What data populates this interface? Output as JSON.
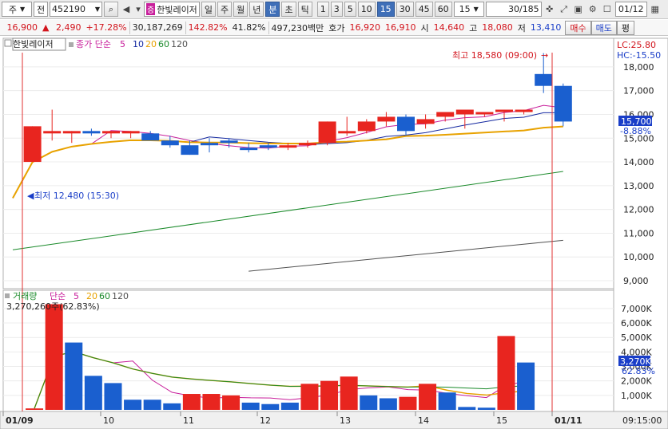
{
  "toolbar": {
    "market": "주",
    "market_label": "전",
    "code": "452190",
    "badge": "증",
    "stock_name": "한빛레이저",
    "periods": [
      "일",
      "주",
      "월",
      "년",
      "분",
      "초",
      "틱"
    ],
    "active_period": "분",
    "intervals": [
      "1",
      "3",
      "5",
      "10",
      "15",
      "30",
      "45",
      "60"
    ],
    "active_interval": "15",
    "interval_value": "15",
    "count": "30/185",
    "date": "01/12"
  },
  "quote": {
    "price": "16,900",
    "change": "2,490",
    "change_pct": "+17.28%",
    "volume": "30,187,269",
    "vol_ratio": "142.82%",
    "turnover_ratio": "41.82%",
    "trade_value": "497,230백만",
    "ask_label": "호가",
    "ask": "16,920",
    "bid": "16,910",
    "open_label": "시",
    "open": "14,640",
    "high_label": "고",
    "high": "18,080",
    "low_label": "저",
    "low": "13,410",
    "buy_btn": "매수",
    "sell_btn": "매도",
    "extra_btn": "평"
  },
  "price_panel": {
    "stock_label": "한빛레이저",
    "ma_label": "종가 단순",
    "ma_periods": [
      "5",
      "10",
      "20",
      "60",
      "120"
    ],
    "ma_colors": [
      "#c81e9b",
      "#1428a0",
      "#e8a200",
      "#1a8a2a",
      "#505050"
    ],
    "lc": "LC:25.80",
    "hc": "HC:-15.50",
    "high_note": "최고 18,580 (09:00)",
    "low_note": "최저 12,480 (15:30)",
    "current_price": "15,700",
    "current_pct": "-8.88%",
    "axis_ticks": [
      18000,
      17000,
      16000,
      15000,
      14000,
      13000,
      12000,
      11000,
      10000,
      9000
    ]
  },
  "volume_panel": {
    "label": "거래량",
    "ma_label": "단순",
    "ma_periods": [
      "5",
      "20",
      "60",
      "120"
    ],
    "ma_colors": [
      "#c81e9b",
      "#e8a200",
      "#1a8a2a",
      "#505050"
    ],
    "value_note": "3,270,260주(62.83%)",
    "current": "3,270K",
    "current_pct": "62.83%",
    "axis_ticks": [
      "7,000K",
      "6,000K",
      "5,000K",
      "4,000K",
      "3,000K",
      "2,000K",
      "1,000K"
    ]
  },
  "x_axis": {
    "labels": [
      "01/09",
      "10",
      "11",
      "12",
      "13",
      "14",
      "15",
      "01/11"
    ],
    "time": "09:15:00"
  },
  "chart_data": {
    "type": "candlestick",
    "x": [
      "01/09 15:30",
      "01/10 09:00",
      "01/10 09:15",
      "01/10 09:30",
      "01/10 09:45",
      "01/10 10:00",
      "01/10 10:15",
      "01/10 10:30",
      "01/10 10:45",
      "01/10 11:00",
      "01/10 11:15",
      "01/10 11:30",
      "01/10 11:45",
      "01/10 12:00",
      "01/10 12:15",
      "01/10 12:30",
      "01/10 12:45",
      "01/10 13:00",
      "01/10 13:15",
      "01/10 13:30",
      "01/10 13:45",
      "01/10 14:00",
      "01/10 14:15",
      "01/10 14:30",
      "01/10 14:45",
      "01/10 15:00",
      "01/10 15:15",
      "01/11 09:00",
      "01/11 09:15"
    ],
    "open": [
      12480,
      14000,
      15200,
      15200,
      15300,
      15200,
      15200,
      15200,
      14900,
      14700,
      14800,
      14900,
      14600,
      14700,
      14600,
      14700,
      14800,
      15200,
      15300,
      15700,
      15900,
      15600,
      15900,
      16000,
      16000,
      16100,
      16100,
      17700,
      17200
    ],
    "high": [
      12480,
      15500,
      16200,
      15300,
      15400,
      15300,
      15300,
      15300,
      15100,
      14900,
      15000,
      15000,
      14800,
      14800,
      14800,
      14900,
      15700,
      15900,
      15800,
      16100,
      16000,
      16000,
      16000,
      16100,
      16100,
      16200,
      16200,
      18580,
      17300
    ],
    "low": [
      12480,
      14000,
      14900,
      14800,
      15100,
      15000,
      15000,
      15000,
      14600,
      14300,
      14400,
      14600,
      14400,
      14500,
      14500,
      14600,
      14700,
      15100,
      15200,
      15500,
      15100,
      15400,
      15700,
      15400,
      15900,
      15700,
      16000,
      16900,
      15500
    ],
    "close": [
      12480,
      15500,
      15300,
      15300,
      15200,
      15300,
      15300,
      14900,
      14700,
      14300,
      14700,
      14800,
      14500,
      14600,
      14700,
      14800,
      15700,
      15300,
      15700,
      15900,
      15300,
      15800,
      16100,
      16200,
      16100,
      16200,
      16200,
      17200,
      15700
    ],
    "volume": [
      100,
      7300,
      4650,
      2350,
      1850,
      700,
      700,
      450,
      1100,
      1100,
      1000,
      500,
      400,
      500,
      1800,
      2000,
      2300,
      1000,
      800,
      900,
      1800,
      1200,
      200,
      150,
      5100,
      3270
    ],
    "volume_dir": [
      "up",
      "up",
      "down",
      "down",
      "down",
      "down",
      "down",
      "down",
      "up",
      "up",
      "up",
      "down",
      "down",
      "down",
      "up",
      "up",
      "up",
      "down",
      "down",
      "up",
      "up",
      "down",
      "down",
      "down",
      "up",
      "down"
    ],
    "ylim_price": [
      8800,
      18600
    ],
    "ylim_volume": [
      0,
      7600
    ]
  }
}
